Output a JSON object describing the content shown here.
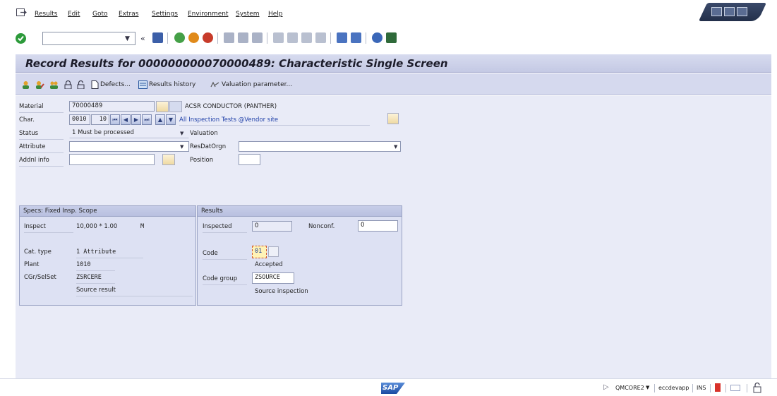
{
  "menu": {
    "items": [
      "Results",
      "Edit",
      "Goto",
      "Extras",
      "Settings",
      "Environment",
      "System",
      "Help"
    ]
  },
  "toolbar": {
    "command_field_value": "",
    "icons": [
      "ok-icon",
      "back-arrows-icon",
      "save-icon",
      "back-icon",
      "exit-icon",
      "cancel-icon",
      "print-icon",
      "find-icon",
      "find-next-icon",
      "first-page-icon",
      "previous-page-icon",
      "next-page-icon",
      "last-page-icon",
      "create-session-icon",
      "shortcut-icon",
      "help-icon",
      "customize-layout-icon"
    ]
  },
  "page": {
    "title": "Record Results for 000000000070000489: Characteristic Single Screen"
  },
  "app_toolbar": {
    "defects_label": "Defects...",
    "results_history_label": "Results history",
    "valuation_parameter_label": "Valuation parameter..."
  },
  "form": {
    "material_label": "Material",
    "material_value": "70000489",
    "material_desc": "ACSR CONDUCTOR (PANTHER)",
    "char_label": "Char.",
    "char_value": "0010",
    "char_no": "10",
    "char_desc": "All Inspection Tests @Vendor site",
    "status_label": "Status",
    "status_value": "1 Must be processed",
    "valuation_label": "Valuation",
    "attribute_label": "Attribute",
    "attribute_value": "",
    "resdatorgn_label": "ResDatOrgn",
    "resdatorgn_value": "",
    "addnl_info_label": "Addnl info",
    "addnl_info_value": "",
    "position_label": "Position",
    "position_value": ""
  },
  "specs": {
    "header": "Specs: Fixed Insp. Scope",
    "inspect_label": "Inspect",
    "inspect_value": "10,000 * 1.00",
    "inspect_unit": "M",
    "cat_type_label": "Cat. type",
    "cat_type_value": "1 Attribute",
    "plant_label": "Plant",
    "plant_value": "1010",
    "cgr_label": "CGr/SelSet",
    "cgr_value": "ZSRCERE",
    "source_result": "Source result"
  },
  "results": {
    "header": "Results",
    "inspected_label": "Inspected",
    "inspected_value": "0",
    "nonconf_label": "Nonconf.",
    "nonconf_value": "0",
    "code_label": "Code",
    "code_value": "01",
    "code_text": "Accepted",
    "code_group_label": "Code group",
    "code_group_value": "ZSOURCE",
    "source_inspection": "Source inspection"
  },
  "statusbar": {
    "logo": "SAP",
    "system": "QMCORE2",
    "server": "eccdevapp",
    "mode": "INS"
  }
}
